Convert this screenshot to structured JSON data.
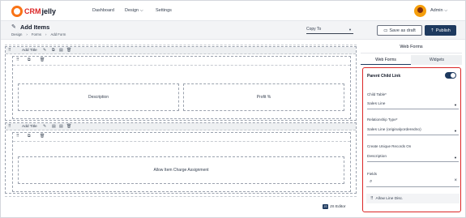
{
  "nav": {
    "logo_crm": "CRM",
    "logo_jelly": "jelly",
    "items": [
      "Dashboard",
      "Design",
      "Settings"
    ],
    "design_caret": "⌵",
    "user": "Admin",
    "user_caret": "⌵"
  },
  "header": {
    "title": "Add  Items",
    "breadcrumb": [
      "Design",
      "Forms",
      "Add Form"
    ],
    "breadcrumb_sep": "›",
    "copy_to": "Copy To",
    "save_draft": "Save as draft",
    "publish": "Publish"
  },
  "canvas": {
    "rows": [
      {
        "label": "Add Title",
        "fields": [
          "Description",
          "Profit %"
        ]
      },
      {
        "label": "Add Title",
        "fields": [
          "Allow Item Charge Assignment"
        ]
      }
    ],
    "js_badge": "JS",
    "js_editor": "JS Editor"
  },
  "panel": {
    "title": "Web Forms",
    "tabs": [
      "Web Forms",
      "Widgets"
    ],
    "parent_child_link": "Parent Child Link",
    "toggle_on": true,
    "child_table_label": "Child Table*",
    "child_table_value": "Sales Line",
    "relationship_label": "Relationship Type*",
    "relationship_value": "Sales Line (originalyorderedno)",
    "unique_label": "Create Unique Records On",
    "unique_value": "Description",
    "fields_label": "Fields",
    "field_items": [
      "Allow Line Disc."
    ]
  },
  "colors": {
    "accent": "#1e3a5f",
    "highlight_border": "#dc2626",
    "logo": "#dc2626"
  }
}
